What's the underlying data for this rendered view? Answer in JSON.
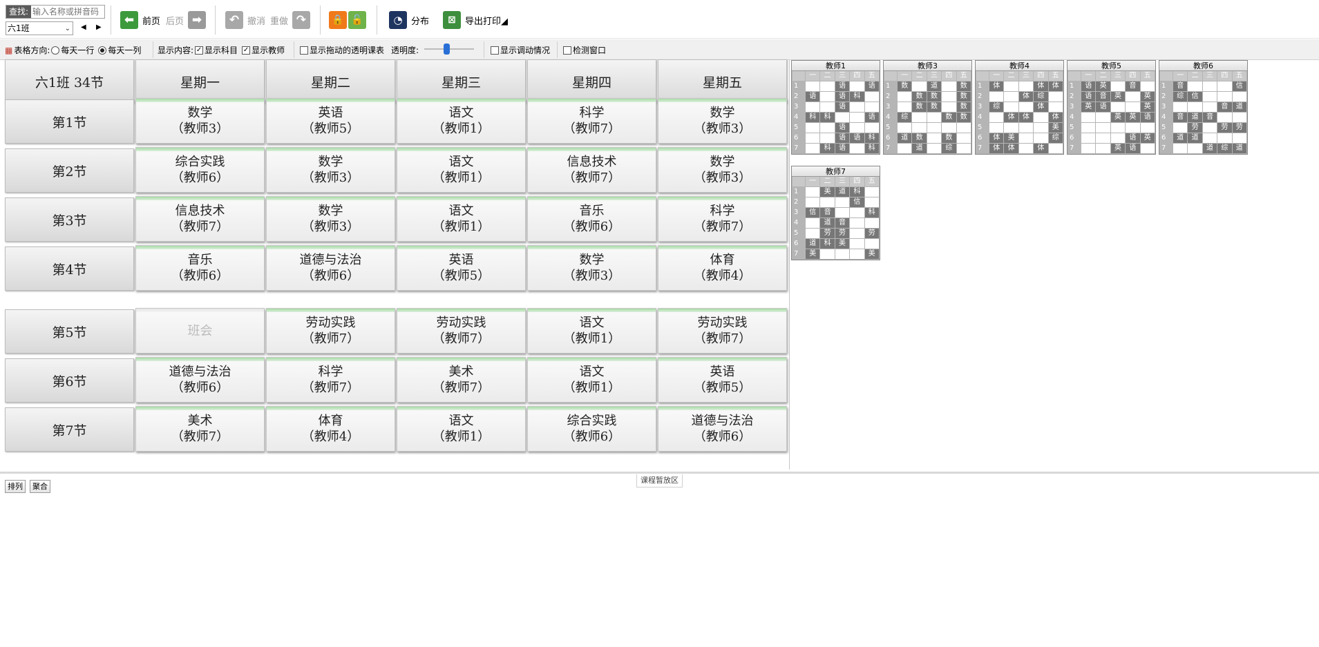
{
  "toolbar": {
    "search_label": "查找:",
    "search_placeholder": "输入名称或拼音码",
    "class_selected": "六1班",
    "prev_page": "前页",
    "next_page": "后页",
    "undo": "撤消",
    "redo": "重做",
    "distribution": "分布",
    "export_print": "导出打印◢"
  },
  "options": {
    "direction_label": "表格方向:",
    "row_per_day": "每天一行",
    "col_per_day": "每天一列",
    "display_label": "显示内容:",
    "show_subject": "显示科目",
    "show_teacher": "显示教师",
    "show_drag_transparent": "显示拖动的透明课表",
    "opacity_label": "透明度:",
    "show_adjust": "显示调动情况",
    "detect_window": "检测窗口"
  },
  "schedule": {
    "corner": "六1班 34节",
    "days": [
      "星期一",
      "星期二",
      "星期三",
      "星期四",
      "星期五"
    ],
    "periods": [
      {
        "label": "第1节",
        "cells": [
          [
            "数学",
            "（教师3）"
          ],
          [
            "英语",
            "（教师5）"
          ],
          [
            "语文",
            "（教师1）"
          ],
          [
            "科学",
            "（教师7）"
          ],
          [
            "数学",
            "（教师3）"
          ]
        ]
      },
      {
        "label": "第2节",
        "cells": [
          [
            "综合实践",
            "（教师6）"
          ],
          [
            "数学",
            "（教师3）"
          ],
          [
            "语文",
            "（教师1）"
          ],
          [
            "信息技术",
            "（教师7）"
          ],
          [
            "数学",
            "（教师3）"
          ]
        ]
      },
      {
        "label": "第3节",
        "cells": [
          [
            "信息技术",
            "（教师7）"
          ],
          [
            "数学",
            "（教师3）"
          ],
          [
            "语文",
            "（教师1）"
          ],
          [
            "音乐",
            "（教师6）"
          ],
          [
            "科学",
            "（教师7）"
          ]
        ]
      },
      {
        "label": "第4节",
        "cells": [
          [
            "音乐",
            "（教师6）"
          ],
          [
            "道德与法治",
            "（教师6）"
          ],
          [
            "英语",
            "（教师5）"
          ],
          [
            "数学",
            "（教师3）"
          ],
          [
            "体育",
            "（教师4）"
          ]
        ]
      },
      {
        "label": "第5节",
        "cells": [
          [
            "班会",
            ""
          ],
          [
            "劳动实践",
            "（教师7）"
          ],
          [
            "劳动实践",
            "（教师7）"
          ],
          [
            "语文",
            "（教师1）"
          ],
          [
            "劳动实践",
            "（教师7）"
          ]
        ]
      },
      {
        "label": "第6节",
        "cells": [
          [
            "道德与法治",
            "（教师6）"
          ],
          [
            "科学",
            "（教师7）"
          ],
          [
            "美术",
            "（教师7）"
          ],
          [
            "语文",
            "（教师1）"
          ],
          [
            "英语",
            "（教师5）"
          ]
        ]
      },
      {
        "label": "第7节",
        "cells": [
          [
            "美术",
            "（教师7）"
          ],
          [
            "体育",
            "（教师4）"
          ],
          [
            "语文",
            "（教师1）"
          ],
          [
            "综合实践",
            "（教师6）"
          ],
          [
            "道德与法治",
            "（教师6）"
          ]
        ]
      }
    ]
  },
  "mini_tables": {
    "day_headers": [
      "一",
      "二",
      "三",
      "四",
      "五"
    ],
    "period_numbers": [
      "1",
      "2",
      "3",
      "4",
      "5",
      "6",
      "7"
    ],
    "teachers": [
      {
        "name": "教师1",
        "rows": [
          [
            "",
            "",
            "语",
            "",
            "语"
          ],
          [
            "语",
            "",
            "语",
            "科",
            ""
          ],
          [
            "",
            "",
            "语",
            "",
            ""
          ],
          [
            "科",
            "科",
            "",
            "",
            "语"
          ],
          [
            "",
            "",
            "语",
            "",
            ""
          ],
          [
            "",
            "",
            "语",
            "语",
            "科"
          ],
          [
            "",
            "科",
            "语",
            "",
            "科"
          ]
        ],
        "filled": [
          [
            0,
            0,
            1,
            0,
            1
          ],
          [
            1,
            0,
            1,
            1,
            0
          ],
          [
            0,
            0,
            1,
            0,
            0
          ],
          [
            1,
            1,
            0,
            0,
            1
          ],
          [
            0,
            0,
            1,
            0,
            0
          ],
          [
            0,
            0,
            1,
            1,
            1
          ],
          [
            0,
            1,
            1,
            0,
            1
          ]
        ]
      },
      {
        "name": "教师3",
        "rows": [
          [
            "数",
            "",
            "道",
            "",
            "数"
          ],
          [
            "",
            "数",
            "数",
            "",
            "数"
          ],
          [
            "",
            "数",
            "数",
            "",
            "数"
          ],
          [
            "综",
            "",
            "",
            "数",
            "数"
          ],
          [
            "",
            "",
            "",
            "",
            ""
          ],
          [
            "道",
            "数",
            "",
            "数",
            ""
          ],
          [
            "",
            "道",
            "",
            "综",
            ""
          ]
        ],
        "filled": [
          [
            1,
            0,
            1,
            0,
            1
          ],
          [
            0,
            1,
            1,
            0,
            1
          ],
          [
            0,
            1,
            1,
            0,
            1
          ],
          [
            1,
            0,
            0,
            1,
            1
          ],
          [
            0,
            0,
            0,
            0,
            0
          ],
          [
            1,
            1,
            0,
            1,
            0
          ],
          [
            0,
            1,
            0,
            1,
            0
          ]
        ]
      },
      {
        "name": "教师4",
        "rows": [
          [
            "体",
            "",
            "",
            "体",
            "体"
          ],
          [
            "",
            "",
            "体",
            "综",
            ""
          ],
          [
            "综",
            "",
            "",
            "体",
            ""
          ],
          [
            "",
            "体",
            "体",
            "",
            "体"
          ],
          [
            "",
            "",
            "",
            "",
            "美"
          ],
          [
            "体",
            "美",
            "",
            "",
            "综"
          ],
          [
            "体",
            "体",
            "",
            "体",
            ""
          ]
        ],
        "filled": [
          [
            1,
            0,
            0,
            1,
            1
          ],
          [
            0,
            0,
            1,
            1,
            0
          ],
          [
            1,
            0,
            0,
            1,
            0
          ],
          [
            0,
            1,
            1,
            0,
            1
          ],
          [
            0,
            0,
            0,
            0,
            1
          ],
          [
            1,
            1,
            0,
            0,
            1
          ],
          [
            1,
            1,
            0,
            1,
            0
          ]
        ]
      },
      {
        "name": "教师5",
        "rows": [
          [
            "语",
            "英",
            "",
            "音",
            ""
          ],
          [
            "语",
            "音",
            "英",
            "",
            "英"
          ],
          [
            "英",
            "语",
            "",
            "",
            "英"
          ],
          [
            "",
            "",
            "英",
            "英",
            "语"
          ],
          [
            "",
            "",
            "",
            "",
            ""
          ],
          [
            "",
            "",
            "",
            "语",
            "英"
          ],
          [
            "",
            "",
            "英",
            "语",
            ""
          ]
        ],
        "filled": [
          [
            1,
            1,
            0,
            1,
            0
          ],
          [
            1,
            1,
            1,
            0,
            1
          ],
          [
            1,
            1,
            0,
            0,
            1
          ],
          [
            0,
            0,
            1,
            1,
            1
          ],
          [
            0,
            0,
            0,
            0,
            0
          ],
          [
            0,
            0,
            0,
            1,
            1
          ],
          [
            0,
            0,
            1,
            1,
            0
          ]
        ]
      },
      {
        "name": "教师6",
        "rows": [
          [
            "音",
            "",
            "",
            "",
            "信"
          ],
          [
            "综",
            "信",
            "",
            "",
            ""
          ],
          [
            "",
            "",
            "",
            "音",
            "道"
          ],
          [
            "音",
            "道",
            "音",
            "",
            ""
          ],
          [
            "",
            "劳",
            "",
            "劳",
            "劳"
          ],
          [
            "道",
            "道",
            "",
            "",
            ""
          ],
          [
            "",
            "",
            "道",
            "综",
            "道"
          ]
        ],
        "filled": [
          [
            1,
            0,
            0,
            0,
            1
          ],
          [
            1,
            1,
            0,
            0,
            0
          ],
          [
            0,
            0,
            0,
            1,
            1
          ],
          [
            1,
            1,
            1,
            0,
            0
          ],
          [
            0,
            1,
            0,
            1,
            1
          ],
          [
            1,
            1,
            0,
            0,
            0
          ],
          [
            0,
            0,
            1,
            1,
            1
          ]
        ]
      },
      {
        "name": "教师7",
        "rows": [
          [
            "",
            "美",
            "道",
            "科",
            ""
          ],
          [
            "",
            "",
            "",
            "信",
            ""
          ],
          [
            "信",
            "音",
            "",
            "",
            "科"
          ],
          [
            "",
            "道",
            "音",
            "",
            ""
          ],
          [
            "",
            "劳",
            "劳",
            "",
            "劳"
          ],
          [
            "道",
            "科",
            "美",
            "",
            ""
          ],
          [
            "美",
            "",
            "",
            "",
            "美"
          ]
        ],
        "filled": [
          [
            0,
            1,
            1,
            1,
            0
          ],
          [
            0,
            0,
            0,
            1,
            0
          ],
          [
            1,
            1,
            0,
            0,
            1
          ],
          [
            0,
            1,
            1,
            0,
            0
          ],
          [
            0,
            1,
            1,
            0,
            1
          ],
          [
            1,
            1,
            1,
            0,
            0
          ],
          [
            1,
            0,
            0,
            0,
            1
          ]
        ]
      }
    ]
  },
  "stash": {
    "sort_button": "排列",
    "merge_button": "聚合",
    "area_label": "课程暂放区"
  },
  "colors": {
    "accent_green": "#3c9a3c",
    "lock_orange": "#f07a1a",
    "unlock_green": "#6fb34a",
    "slider_blue": "#2a6fd6"
  }
}
